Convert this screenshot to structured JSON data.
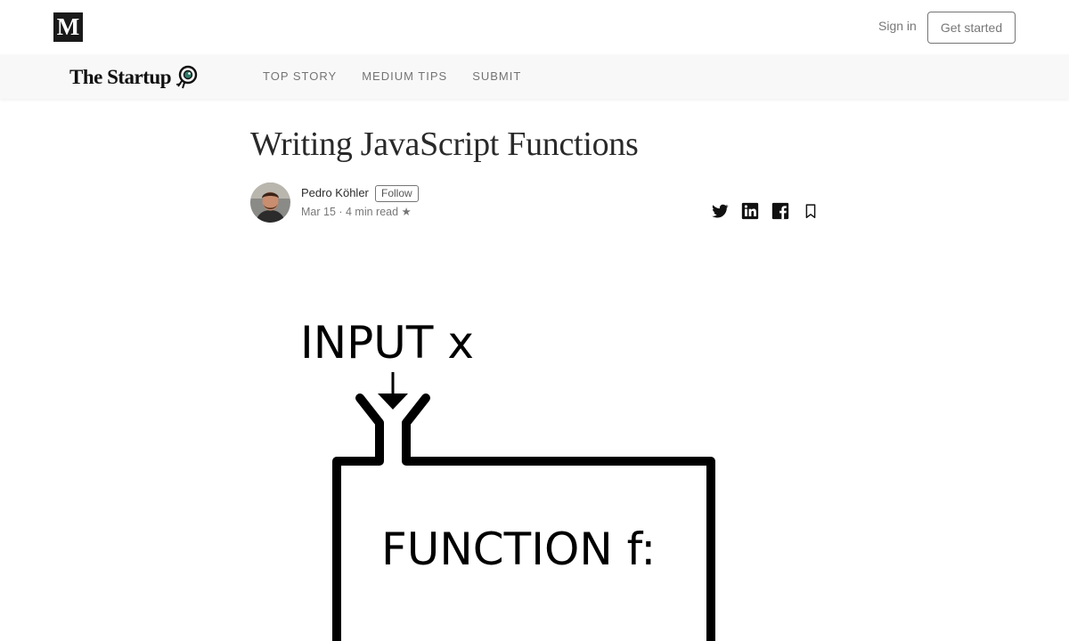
{
  "topbar": {
    "logo_letter": "M",
    "sign_in": "Sign in",
    "get_started": "Get started"
  },
  "publication": {
    "name": "The Startup",
    "nav": [
      "TOP STORY",
      "MEDIUM TIPS",
      "SUBMIT"
    ]
  },
  "article": {
    "title": "Writing JavaScript Functions",
    "author": "Pedro Köhler",
    "follow_label": "Follow",
    "meta": "Mar 15 · 4 min read ★"
  },
  "share": {
    "icons": [
      "twitter-icon",
      "linkedin-icon",
      "facebook-icon",
      "bookmark-icon"
    ]
  },
  "hero": {
    "input_label": "INPUT x",
    "function_label": "FUNCTION f:"
  },
  "colors": {
    "text_primary": "#1f1f1f",
    "text_muted": "#757575",
    "pub_bar_bg": "#f8f8f8",
    "logo_bg": "#1a1a1a"
  }
}
